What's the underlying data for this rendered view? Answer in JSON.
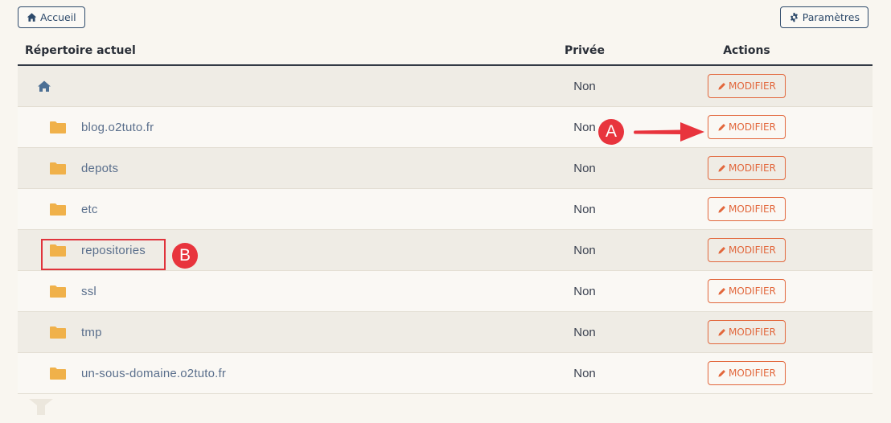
{
  "toolbar": {
    "home_label": "Accueil",
    "settings_label": "Paramètres"
  },
  "table": {
    "headers": {
      "name": "Répertoire actuel",
      "private": "Privée",
      "actions": "Actions"
    },
    "action_label": "MODIFIER",
    "rows": [
      {
        "name": "",
        "icon": "home-icon",
        "private": "Non"
      },
      {
        "name": "blog.o2tuto.fr",
        "icon": "folder-icon",
        "private": "Non"
      },
      {
        "name": "depots",
        "icon": "folder-icon",
        "private": "Non"
      },
      {
        "name": "etc",
        "icon": "folder-icon",
        "private": "Non"
      },
      {
        "name": "repositories",
        "icon": "folder-icon",
        "private": "Non"
      },
      {
        "name": "ssl",
        "icon": "folder-icon",
        "private": "Non"
      },
      {
        "name": "tmp",
        "icon": "folder-icon",
        "private": "Non"
      },
      {
        "name": "un-sous-domaine.o2tuto.fr",
        "icon": "folder-icon",
        "private": "Non"
      }
    ]
  },
  "annotations": {
    "a_label": "A",
    "b_label": "B"
  },
  "colors": {
    "accent": "#e2673c",
    "folder": "#f0b14a",
    "annotation": "#e8343d",
    "nav": "#2e4a6b"
  }
}
